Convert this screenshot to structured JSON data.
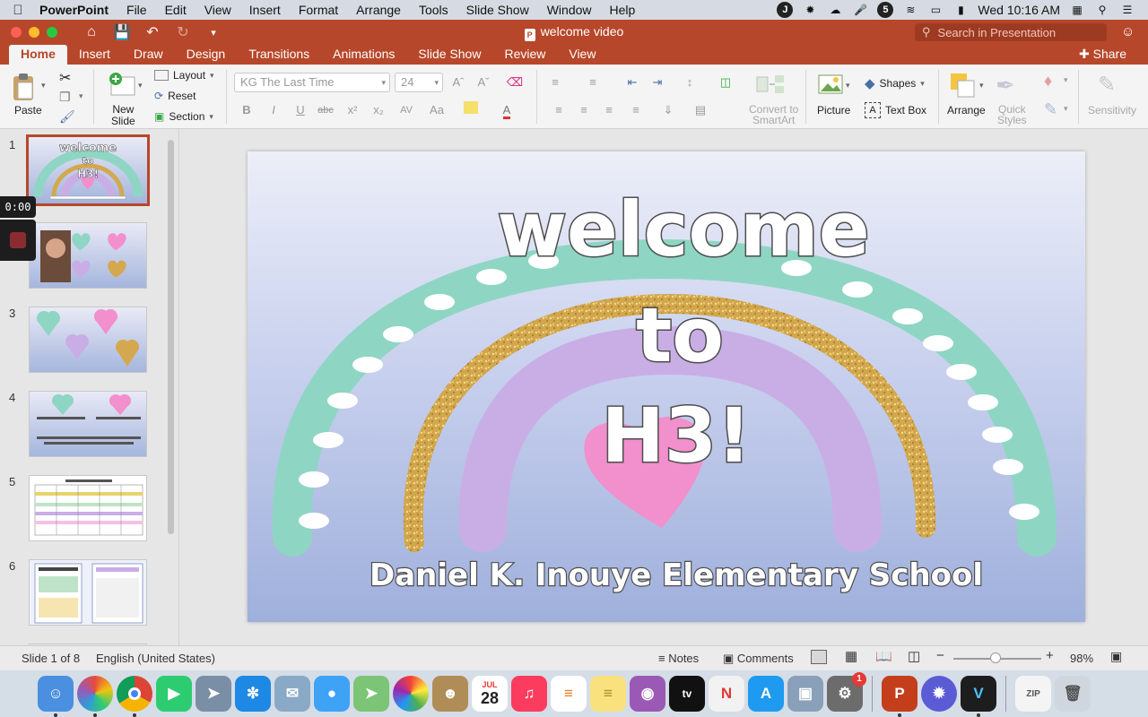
{
  "menubar": {
    "app": "PowerPoint",
    "items": [
      "File",
      "Edit",
      "View",
      "Insert",
      "Format",
      "Arrange",
      "Tools",
      "Slide Show",
      "Window",
      "Help"
    ],
    "clock": "Wed 10:16 AM"
  },
  "titlebar": {
    "doc_title": "welcome video",
    "search_placeholder": "Search in Presentation"
  },
  "tabs": {
    "items": [
      "Home",
      "Insert",
      "Draw",
      "Design",
      "Transitions",
      "Animations",
      "Slide Show",
      "Review",
      "View"
    ],
    "active": "Home",
    "share": "Share"
  },
  "ribbon": {
    "paste": "Paste",
    "new_slide": "New\nSlide",
    "layout": "Layout",
    "reset": "Reset",
    "section": "Section",
    "font_name": "KG The Last Time",
    "font_size": "24",
    "convert_smartart": "Convert to\nSmartArt",
    "picture": "Picture",
    "shapes": "Shapes",
    "text_box": "Text Box",
    "arrange": "Arrange",
    "quick_styles": "Quick\nStyles",
    "sensitivity": "Sensitivity"
  },
  "thumbnails": {
    "numbers": [
      "1",
      "2",
      "3",
      "4",
      "5",
      "6"
    ],
    "slide1": {
      "line1": "welcome",
      "line2": "to",
      "line3": "H3!"
    }
  },
  "recording": {
    "time": "0:00"
  },
  "slide": {
    "title_line1": "welcome",
    "title_line2": "to",
    "title_line3": "H3!",
    "footer": "Daniel K. Inouye Elementary School"
  },
  "status": {
    "slide_info": "Slide 1 of 8",
    "language": "English (United States)",
    "notes": "Notes",
    "comments": "Comments",
    "zoom": "98%"
  },
  "dock": {
    "calendar_month": "JUL",
    "calendar_day": "28",
    "badge_count": "1"
  },
  "colors": {
    "accent": "#b7472a",
    "rainbow_outer": "#8ed6c3",
    "rainbow_glitter": "#d4a84e",
    "rainbow_inner": "#c9aee6",
    "heart": "#f28fcd"
  }
}
